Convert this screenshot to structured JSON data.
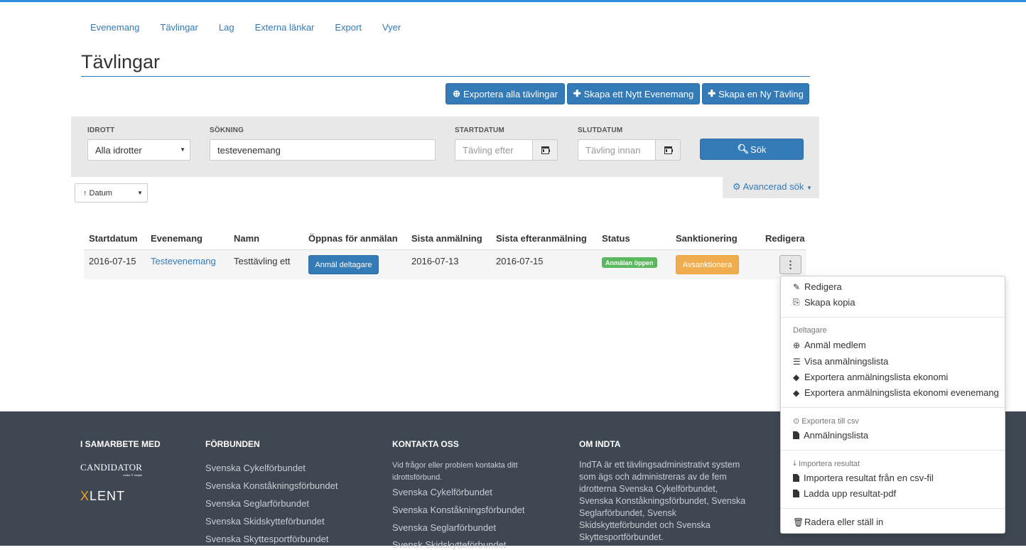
{
  "nav": [
    "Evenemang",
    "Tävlingar",
    "Lag",
    "Externa länkar",
    "Export",
    "Vyer"
  ],
  "page_title": "Tävlingar",
  "actions": {
    "export_all": "Exportera alla tävlingar",
    "new_event": "Skapa ett Nytt Evenemang",
    "new_competition": "Skapa en Ny Tävling"
  },
  "filters": {
    "sport_label": "IDROTT",
    "sport_value": "Alla idrotter",
    "search_label": "SÖKNING",
    "search_value": "testevenemang",
    "start_label": "STARTDATUM",
    "start_placeholder": "Tävling efter",
    "end_label": "SLUTDATUM",
    "end_placeholder": "Tävling innan",
    "search_button": "Sök",
    "advanced": "Avancerad sök"
  },
  "sort": {
    "value": "↑ Datum"
  },
  "table": {
    "headers": [
      "Startdatum",
      "Evenemang",
      "Namn",
      "Öppnas för anmälan",
      "Sista anmälning",
      "Sista efteranmälning",
      "Status",
      "Sanktionering",
      "Redigera"
    ],
    "row": {
      "start": "2016-07-15",
      "event": "Testevenemang",
      "name": "Testtävling ett",
      "register_button": "Anmäl deltagare",
      "last_reg": "2016-07-13",
      "last_late_reg": "2016-07-15",
      "status": "Anmälan öppen",
      "sanction_button": "Avsanktionera",
      "kebab": "⋮"
    }
  },
  "menu": {
    "edit": "Redigera",
    "copy": "Skapa kopia",
    "participants_header": "Deltagare",
    "register_member": "Anmäl medlem",
    "show_list": "Visa anmälningslista",
    "export_economy": "Exportera anmälningslista ekonomi",
    "export_economy_event": "Exportera anmälningslista ekonomi evenemang",
    "export_csv_header": "Exportera till csv",
    "registration_list": "Anmälningslista",
    "import_header": "Importera resultat",
    "import_csv": "Importera resultat från en csv-fil",
    "upload_pdf": "Ladda upp resultat-pdf",
    "delete": "Radera eller ställ in"
  },
  "footer": {
    "partners_heading": "I SAMARBETE MED",
    "partner_candidator": "CANDIDATOR",
    "partner_candidator_tagline": "make IT simple",
    "partner_xlent_x": "X",
    "partner_xlent_rest": "LENT",
    "federations_heading": "FÖRBUNDEN",
    "federations": [
      "Svenska Cykelförbundet",
      "Svenska Konståkningsförbundet",
      "Svenska Seglarförbundet",
      "Svenska Skidskytteförbundet",
      "Svenska Skyttesportförbundet"
    ],
    "contact_heading": "KONTAKTA OSS",
    "contact_text": "Vid frågor eller problem kontakta ditt idrottsförbund.",
    "contact_links": [
      "Svenska Cykelförbundet",
      "Svenska Konståkningsförbundet",
      "Svenska Seglarförbundet",
      "Svensk Skidskytteförbundet"
    ],
    "about_heading": "OM INDTA",
    "about_text": "IndTA är ett tävlingsadministrativt system som ägs och administreras av de fem idrotterna Svenska Cykelförbundet, Svenska Konståkningsförbundet, Svenska Seglarförbundet, Svensk Skidskytteförbundet och Svenska Skyttesportförbundet."
  }
}
